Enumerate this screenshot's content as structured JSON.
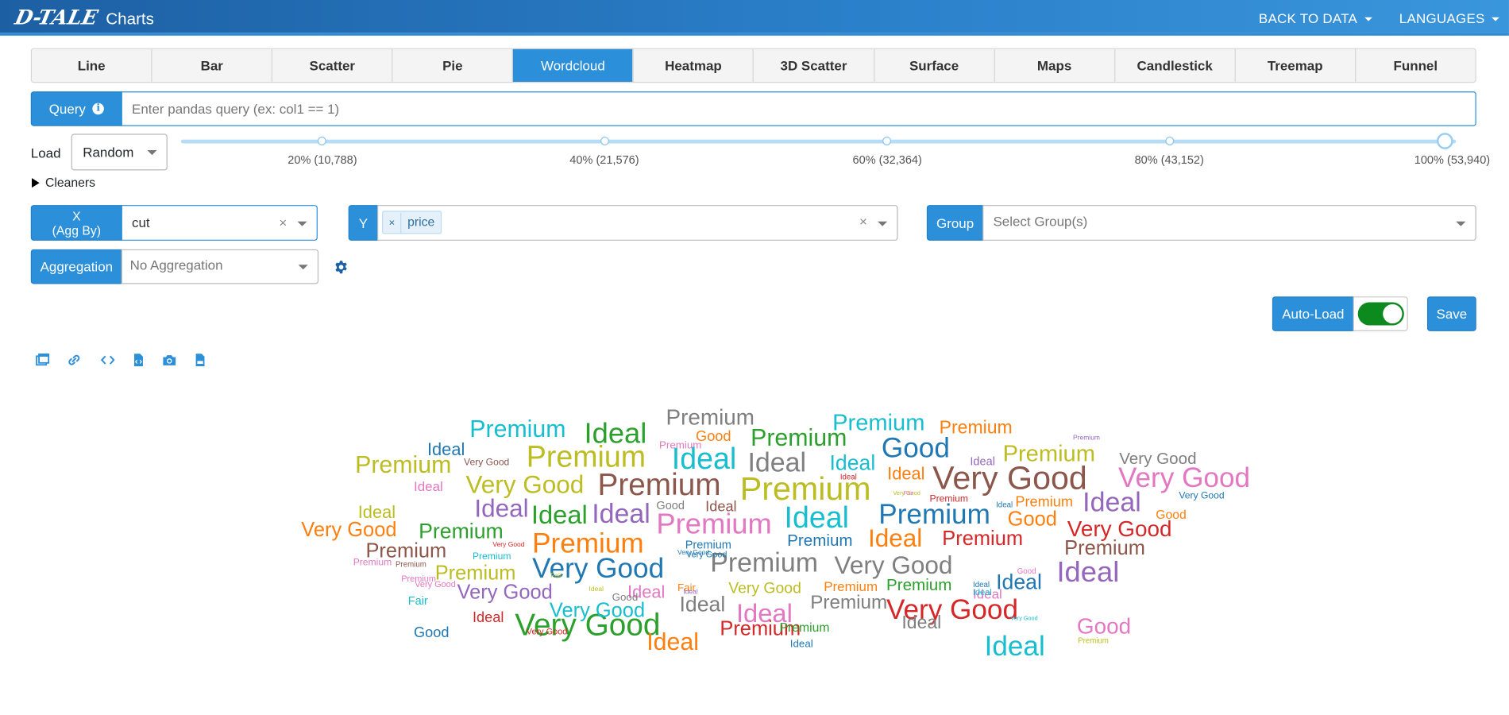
{
  "header": {
    "logo": "D-TALE",
    "title": "Charts",
    "back_to_data": "BACK TO DATA",
    "languages": "LANGUAGES"
  },
  "tabs": [
    "Line",
    "Bar",
    "Scatter",
    "Pie",
    "Wordcloud",
    "Heatmap",
    "3D Scatter",
    "Surface",
    "Maps",
    "Candlestick",
    "Treemap",
    "Funnel"
  ],
  "active_tab": "Wordcloud",
  "query": {
    "label": "Query",
    "info_icon": "i",
    "placeholder": "Enter pandas query (ex: col1 == 1)"
  },
  "load": {
    "label": "Load",
    "value": "Random",
    "slider_labels": [
      "20% (10,788)",
      "40% (21,576)",
      "60% (32,364)",
      "80% (43,152)",
      "100% (53,940)"
    ],
    "slider_value_pct": 100
  },
  "cleaners": {
    "label": "Cleaners"
  },
  "x_axis": {
    "label_line1": "X",
    "label_line2": "(Agg By)",
    "value": "cut",
    "clear": "×"
  },
  "y_axis": {
    "label": "Y",
    "tag_remove": "×",
    "tag_value": "price",
    "clear": "×"
  },
  "group": {
    "label": "Group",
    "placeholder": "Select Group(s)"
  },
  "aggregation": {
    "label": "Aggregation",
    "placeholder": "No Aggregation"
  },
  "autoload": {
    "label": "Auto-Load",
    "on": true
  },
  "save": {
    "label": "Save"
  },
  "toolbar_icons": [
    "popup-icon",
    "link-icon",
    "code-icon",
    "export-file-icon",
    "camera-icon",
    "csv-file-icon"
  ],
  "colors": {
    "primary": "#2b8fd9",
    "toggle_on": "#0d8a1e"
  },
  "wordcloud": [
    {
      "t": "Premium",
      "c": "#17becf",
      "s": 25
    },
    {
      "t": "Ideal",
      "c": "#2ca02c",
      "s": 30
    },
    {
      "t": "Premium",
      "c": "#7f7f7f",
      "s": 23
    },
    {
      "t": "Premium",
      "c": "#17becf",
      "s": 24
    },
    {
      "t": "Premium",
      "c": "#ff7f0e",
      "s": 19
    },
    {
      "t": "Ideal",
      "c": "#1f77b4",
      "s": 18
    },
    {
      "t": "Good",
      "c": "#ff7f0e",
      "s": 15
    },
    {
      "t": "Premium",
      "c": "#2ca02c",
      "s": 25
    },
    {
      "t": "Good",
      "c": "#1f77b4",
      "s": 29
    },
    {
      "t": "Premium",
      "c": "#e377c2",
      "s": 11
    },
    {
      "t": "Premium",
      "c": "#bcbd22",
      "s": 24
    },
    {
      "t": "Premium",
      "c": "#9467bd",
      "s": 7
    },
    {
      "t": "Very Good",
      "c": "#7f7f7f",
      "s": 17
    },
    {
      "t": "Premium",
      "c": "#bcbd22",
      "s": 25
    },
    {
      "t": "Very Good",
      "c": "#8c564b",
      "s": 10
    },
    {
      "t": "Premium",
      "c": "#bcbd22",
      "s": 31
    },
    {
      "t": "Ideal",
      "c": "#17becf",
      "s": 31
    },
    {
      "t": "Ideal",
      "c": "#7f7f7f",
      "s": 28
    },
    {
      "t": "Ideal",
      "c": "#17becf",
      "s": 22
    },
    {
      "t": "Ideal",
      "c": "#9467bd",
      "s": 12
    },
    {
      "t": "Very Good",
      "c": "#8c564b",
      "s": 34
    },
    {
      "t": "Very Good",
      "c": "#e377c2",
      "s": 29
    },
    {
      "t": "Ideal",
      "c": "#d62728",
      "s": 8
    },
    {
      "t": "Ideal",
      "c": "#ff7f0e",
      "s": 18
    },
    {
      "t": "Ideal",
      "c": "#e377c2",
      "s": 14
    },
    {
      "t": "Very Good",
      "c": "#bcbd22",
      "s": 26
    },
    {
      "t": "Premium",
      "c": "#8c564b",
      "s": 32
    },
    {
      "t": "Premium",
      "c": "#bcbd22",
      "s": 34
    },
    {
      "t": "Very Good",
      "c": "#bcbd22",
      "s": 6
    },
    {
      "t": "Premium",
      "c": "#d62728",
      "s": 10
    },
    {
      "t": "Ideal",
      "c": "#1f77b4",
      "s": 8
    },
    {
      "t": "Very Good",
      "c": "#1f77b4",
      "s": 10
    },
    {
      "t": "Ideal",
      "c": "#bcbd22",
      "s": 18
    },
    {
      "t": "Ideal",
      "c": "#9467bd",
      "s": 26
    },
    {
      "t": "Ideal",
      "c": "#2ca02c",
      "s": 27
    },
    {
      "t": "Ideal",
      "c": "#9467bd",
      "s": 28
    },
    {
      "t": "Good",
      "c": "#7f7f7f",
      "s": 12
    },
    {
      "t": "Ideal",
      "c": "#8c564b",
      "s": 15
    },
    {
      "t": "Ideal",
      "c": "#17becf",
      "s": 31
    },
    {
      "t": "Premium",
      "c": "#1f77b4",
      "s": 29
    },
    {
      "t": "Premium",
      "c": "#ff7f0e",
      "s": 15
    },
    {
      "t": "Ideal",
      "c": "#9467bd",
      "s": 28
    },
    {
      "t": "Good",
      "c": "#ff7f0e",
      "s": 13
    },
    {
      "t": "Very Good",
      "c": "#ff7f0e",
      "s": 21
    },
    {
      "t": "Premium",
      "c": "#2ca02c",
      "s": 22
    },
    {
      "t": "Premium",
      "c": "#e377c2",
      "s": 30
    },
    {
      "t": "Good",
      "c": "#ff7f0e",
      "s": 21
    },
    {
      "t": "Premium",
      "c": "#d62728",
      "s": 21
    },
    {
      "t": "Ideal",
      "c": "#ff7f0e",
      "s": 26
    },
    {
      "t": "Very Good",
      "c": "#d62728",
      "s": 23
    },
    {
      "t": "Very Good",
      "c": "#d62728",
      "s": 7
    },
    {
      "t": "Premium",
      "c": "#1f77b4",
      "s": 12
    },
    {
      "t": "Premium",
      "c": "#8c564b",
      "s": 21
    },
    {
      "t": "Premium",
      "c": "#ff7f0e",
      "s": 29
    },
    {
      "t": "Very Good",
      "c": "#1f77b4",
      "s": 7
    },
    {
      "t": "Premium",
      "c": "#1f77b4",
      "s": 17
    },
    {
      "t": "Premium",
      "c": "#8c564b",
      "s": 21
    },
    {
      "t": "Premium",
      "c": "#17becf",
      "s": 10
    },
    {
      "t": "Premium",
      "c": "#e377c2",
      "s": 10
    },
    {
      "t": "Premium",
      "c": "#8c564b",
      "s": 8
    },
    {
      "t": "Premium",
      "c": "#7f7f7f",
      "s": 28
    },
    {
      "t": "Very Good",
      "c": "#7f7f7f",
      "s": 26
    },
    {
      "t": "Premium",
      "c": "#bcbd22",
      "s": 21
    },
    {
      "t": "Very Good",
      "c": "#1f77b4",
      "s": 29
    },
    {
      "t": "Fair",
      "c": "#bcbd22",
      "s": 7
    },
    {
      "t": "Ideal",
      "c": "#1f77b4",
      "s": 22
    },
    {
      "t": "Ideal",
      "c": "#9467bd",
      "s": 30
    },
    {
      "t": "Very Good",
      "c": "#e377c2",
      "s": 9
    },
    {
      "t": "Very Good",
      "c": "#9467bd",
      "s": 21
    },
    {
      "t": "Ideal",
      "c": "#bcbd22",
      "s": 7
    },
    {
      "t": "Ideal",
      "c": "#e377c2",
      "s": 18
    },
    {
      "t": "Fair",
      "c": "#ff7f0e",
      "s": 11
    },
    {
      "t": "Good",
      "c": "#7f7f7f",
      "s": 11
    },
    {
      "t": "Very Good",
      "c": "#bcbd22",
      "s": 16
    },
    {
      "t": "Premium",
      "c": "#ff7f0e",
      "s": 14
    },
    {
      "t": "Premium",
      "c": "#2ca02c",
      "s": 17
    },
    {
      "t": "Ideal",
      "c": "#1f77b4",
      "s": 8
    },
    {
      "t": "Good",
      "c": "#e377c2",
      "s": 8
    },
    {
      "t": "Ideal",
      "c": "#e377c2",
      "s": 14
    },
    {
      "t": "Fair",
      "c": "#17becf",
      "s": 12
    },
    {
      "t": "Ideal",
      "c": "#7f7f7f",
      "s": 22
    },
    {
      "t": "Ideal",
      "c": "#e377c2",
      "s": 27
    },
    {
      "t": "Premium",
      "c": "#7f7f7f",
      "s": 20
    },
    {
      "t": "Very Good",
      "c": "#d62728",
      "s": 29
    },
    {
      "t": "Ideal",
      "c": "#17becf",
      "s": 9
    },
    {
      "t": "Ideal",
      "c": "#d62728",
      "s": 15
    },
    {
      "t": "Very Good",
      "c": "#2ca02c",
      "s": 32
    },
    {
      "t": "Very Good",
      "c": "#17becf",
      "s": 21
    },
    {
      "t": "Ideal",
      "c": "#7f7f7f",
      "s": 19
    },
    {
      "t": "Good",
      "c": "#e377c2",
      "s": 23
    },
    {
      "t": "Good",
      "c": "#1f77b4",
      "s": 15
    },
    {
      "t": "Very Good",
      "c": "#d62728",
      "s": 9
    },
    {
      "t": "Ideal",
      "c": "#ff7f0e",
      "s": 25
    },
    {
      "t": "Premium",
      "c": "#d62728",
      "s": 21
    },
    {
      "t": "Premium",
      "c": "#2ca02c",
      "s": 13
    },
    {
      "t": "Ideal",
      "c": "#1f77b4",
      "s": 11
    },
    {
      "t": "Ideal",
      "c": "#17becf",
      "s": 29
    },
    {
      "t": "Very Good",
      "c": "#17becf",
      "s": 6
    },
    {
      "t": "Premium",
      "c": "#bcbd22",
      "s": 8
    },
    {
      "t": "Fair",
      "c": "#e377c2",
      "s": 6
    },
    {
      "t": "Premium",
      "c": "#e377c2",
      "s": 9
    },
    {
      "t": "Very Good",
      "c": "#1f77b4",
      "s": 9
    },
    {
      "t": "Ideal",
      "c": "#9467bd",
      "s": 7
    }
  ]
}
